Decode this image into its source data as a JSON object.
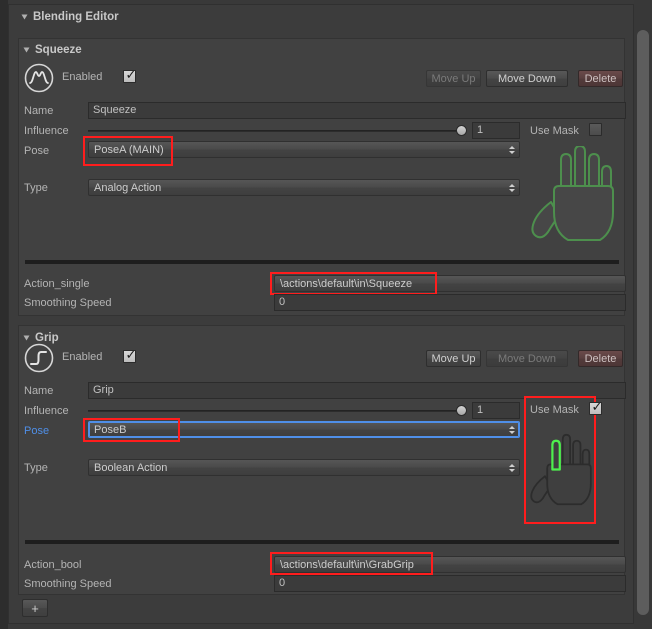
{
  "window": {
    "title": "Blending Editor",
    "background_color": "#393939",
    "panel_color": "#414141",
    "accent_blue": "#4f8fe8",
    "annotation_red": "#ff1d1d",
    "mask_green": "#4ef04e"
  },
  "blocks": [
    {
      "id": "squeeze",
      "title": "Squeeze",
      "icon": "gaussian-curve-icon",
      "enabled_label": "Enabled",
      "enabled_checked": true,
      "buttons": {
        "move_up": "Move Up",
        "move_up_enabled": false,
        "move_down": "Move Down",
        "move_down_enabled": true,
        "delete": "Delete"
      },
      "fields": {
        "name_label": "Name",
        "name_value": "Squeeze",
        "influence_label": "Influence",
        "influence_value": "1",
        "use_mask_label": "Use Mask",
        "use_mask_checked": false,
        "pose_label": "Pose",
        "pose_value": "PoseA (MAIN)",
        "pose_highlighted": true,
        "pose_label_blue": false,
        "type_label": "Type",
        "type_value": "Analog Action",
        "action_label": "Action_single",
        "action_value": "\\actions\\default\\in\\Squeeze",
        "action_highlighted": true,
        "smoothing_label": "Smoothing Speed",
        "smoothing_value": "0"
      },
      "mask": {
        "boxed": false,
        "highlighted_fingers": [
          "thumb",
          "index",
          "middle",
          "ring",
          "pinky",
          "palm"
        ]
      }
    },
    {
      "id": "grip",
      "title": "Grip",
      "icon": "step-curve-icon",
      "enabled_label": "Enabled",
      "enabled_checked": true,
      "buttons": {
        "move_up": "Move Up",
        "move_up_enabled": true,
        "move_down": "Move Down",
        "move_down_enabled": false,
        "delete": "Delete"
      },
      "fields": {
        "name_label": "Name",
        "name_value": "Grip",
        "influence_label": "Influence",
        "influence_value": "1",
        "use_mask_label": "Use Mask",
        "use_mask_checked": true,
        "pose_label": "Pose",
        "pose_value": "PoseB",
        "pose_highlighted": true,
        "pose_label_blue": true,
        "type_label": "Type",
        "type_value": "Boolean Action",
        "action_label": "Action_bool",
        "action_value": "\\actions\\default\\in\\GrabGrip",
        "action_highlighted": true,
        "smoothing_label": "Smoothing Speed",
        "smoothing_value": "0"
      },
      "mask": {
        "boxed": true,
        "highlighted_fingers": [
          "index"
        ]
      }
    }
  ],
  "add_button_label": "+"
}
